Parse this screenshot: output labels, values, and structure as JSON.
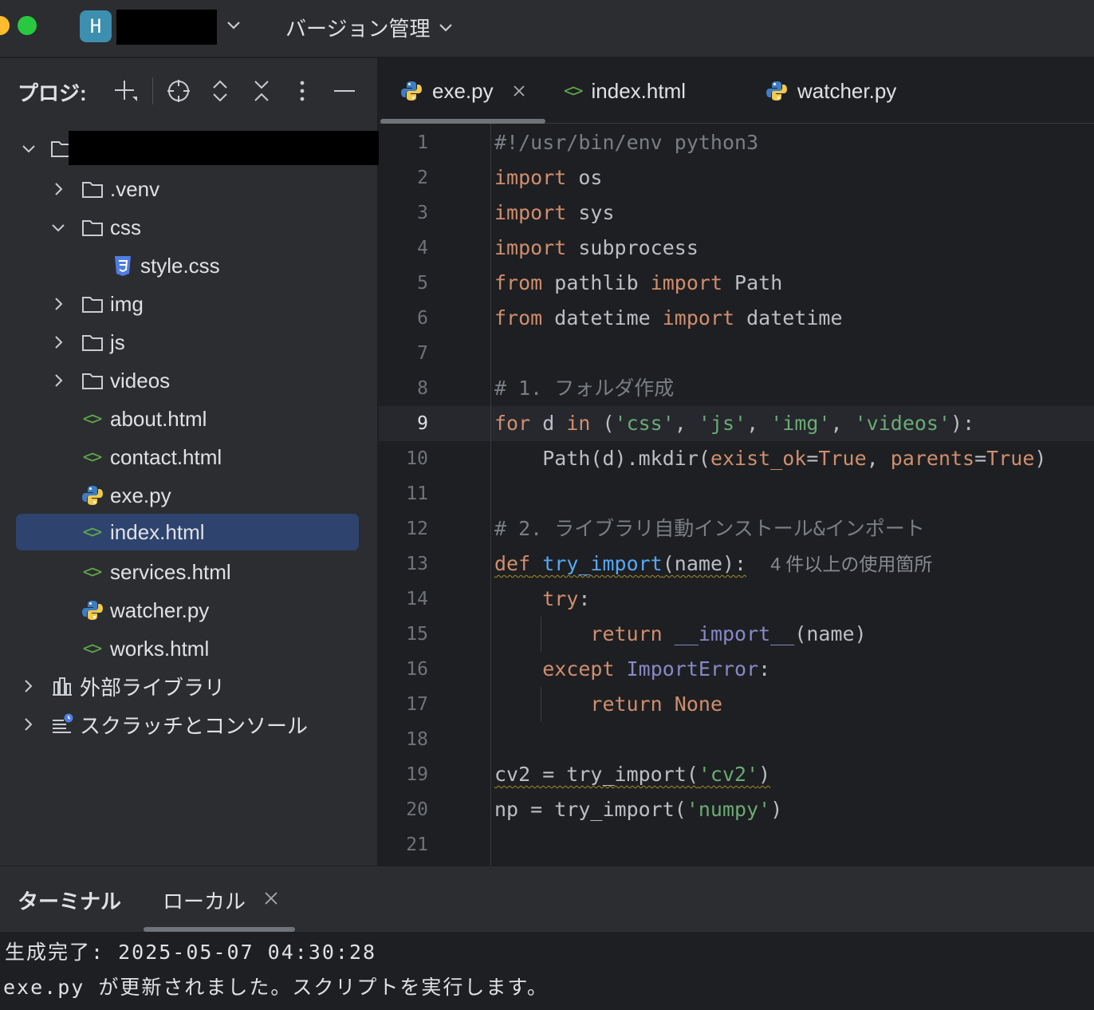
{
  "titlebar": {
    "project_initial": "H",
    "vcs_label": "バージョン管理"
  },
  "project_panel": {
    "title": "プロジ:",
    "toolbar_icons": [
      "add-icon",
      "locate-icon",
      "expand-all-icon",
      "collapse-all-icon",
      "more-icon",
      "hide-icon"
    ],
    "tree": {
      "children": [
        {
          "label": ".venv",
          "type": "folder",
          "expanded": false
        },
        {
          "label": "css",
          "type": "folder",
          "expanded": true
        },
        {
          "label": "style.css",
          "type": "css"
        },
        {
          "label": "img",
          "type": "folder",
          "expanded": false
        },
        {
          "label": "js",
          "type": "folder",
          "expanded": false
        },
        {
          "label": "videos",
          "type": "folder",
          "expanded": false
        },
        {
          "label": "about.html",
          "type": "html"
        },
        {
          "label": "contact.html",
          "type": "html"
        },
        {
          "label": "exe.py",
          "type": "python"
        },
        {
          "label": "index.html",
          "type": "html",
          "selected": true
        },
        {
          "label": "services.html",
          "type": "html"
        },
        {
          "label": "watcher.py",
          "type": "python"
        },
        {
          "label": "works.html",
          "type": "html"
        }
      ],
      "external_libraries": "外部ライブラリ",
      "scratches": "スクラッチとコンソール"
    }
  },
  "editor": {
    "tabs": [
      {
        "label": "exe.py",
        "active": true
      },
      {
        "label": "index.html",
        "active": false
      },
      {
        "label": "watcher.py",
        "active": false
      }
    ],
    "current_line": 9,
    "line_numbers": [
      "1",
      "2",
      "3",
      "4",
      "5",
      "6",
      "7",
      "8",
      "9",
      "10",
      "11",
      "12",
      "13",
      "14",
      "15",
      "16",
      "17",
      "18",
      "19",
      "20",
      "21"
    ],
    "code": {
      "l1": "#!/usr/bin/env python3",
      "l2_kw": "import",
      "l2_rest": " os",
      "l3_kw": "import",
      "l3_rest": " sys",
      "l4_kw": "import",
      "l4_rest": " subprocess",
      "l5_kw1": "from",
      "l5_mid": " pathlib ",
      "l5_kw2": "import",
      "l5_rest": " Path",
      "l6_kw1": "from",
      "l6_mid": " datetime ",
      "l6_kw2": "import",
      "l6_rest": " datetime",
      "l8": "# 1. フォルダ作成",
      "l9_for": "for",
      "l9_d": " d ",
      "l9_in": "in",
      "l9_open": " (",
      "l9_s1": "'css'",
      "l9_c1": ", ",
      "l9_s2": "'js'",
      "l9_c2": ", ",
      "l9_s3": "'img'",
      "l9_c3": ", ",
      "l9_s4": "'videos'",
      "l9_close": "):",
      "l10_a": "    Path(d).mkdir(",
      "l10_p1": "exist_ok",
      "l10_eq1": "=",
      "l10_t1": "True",
      "l10_c": ", ",
      "l10_p2": "parents",
      "l10_eq2": "=",
      "l10_t2": "True",
      "l10_close": ")",
      "l12": "# 2. ライブラリ自動インストール&インポート",
      "l13_def": "def",
      "l13_sp": " ",
      "l13_fn": "try_import",
      "l13_args": "(name):",
      "l13_hint": "4 件以上の使用箇所",
      "l14_ind": "    ",
      "l14_kw": "try",
      "l14_colon": ":",
      "l15_ind": "        ",
      "l15_kw": "return",
      "l15_sp": " ",
      "l15_bi": "__import__",
      "l15_rest": "(name)",
      "l16_ind": "    ",
      "l16_kw": "except",
      "l16_sp": " ",
      "l16_bi": "ImportError",
      "l16_colon": ":",
      "l17_ind": "        ",
      "l17_kw": "return",
      "l17_sp": " ",
      "l17_none": "None",
      "l19_a": "cv2 = try_import(",
      "l19_s": "'cv2'",
      "l19_close": ")",
      "l20_a": "np = try_import(",
      "l20_s": "'numpy'",
      "l20_close": ")"
    }
  },
  "terminal": {
    "title": "ターミナル",
    "tab_label": "ローカル",
    "lines": [
      "生成完了: 2025-05-07 04:30:28",
      "exe.py が更新されました。スクリプトを実行します。"
    ]
  },
  "colors": {
    "keyword": "#cf8e6d",
    "string": "#6aab73",
    "comment": "#7a7e85",
    "function": "#56a8f5",
    "selection": "#2e436e"
  }
}
